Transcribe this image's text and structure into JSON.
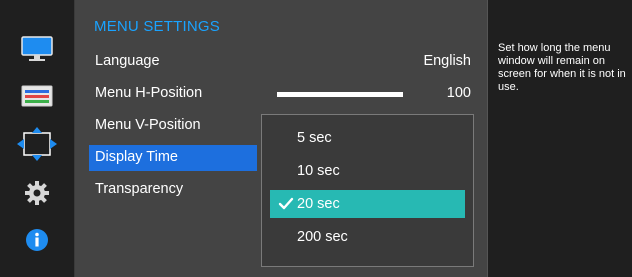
{
  "colors": {
    "accent": "#1aa3ff",
    "selected_row": "#1d6fde",
    "selected_option": "#27b9b3",
    "panel": "#444444",
    "background": "#1c1c1c"
  },
  "sidebar": {
    "items": [
      {
        "name": "picture-icon"
      },
      {
        "name": "color-icon"
      },
      {
        "name": "size-position-icon"
      },
      {
        "name": "system-icon"
      },
      {
        "name": "information-icon"
      }
    ]
  },
  "menu": {
    "title": "MENU SETTINGS",
    "rows": [
      {
        "label": "Language",
        "value": "English"
      },
      {
        "label": "Menu H-Position",
        "value": "100",
        "level": 1.0
      },
      {
        "label": "Menu V-Position"
      },
      {
        "label": "Display Time"
      },
      {
        "label": "Transparency"
      }
    ]
  },
  "dropdown": {
    "options": [
      "5 sec",
      "10 sec",
      "20 sec",
      "200 sec"
    ],
    "selected": "20 sec"
  },
  "help": {
    "text": "Set how long the menu window will remain on screen for when it is not in use."
  }
}
